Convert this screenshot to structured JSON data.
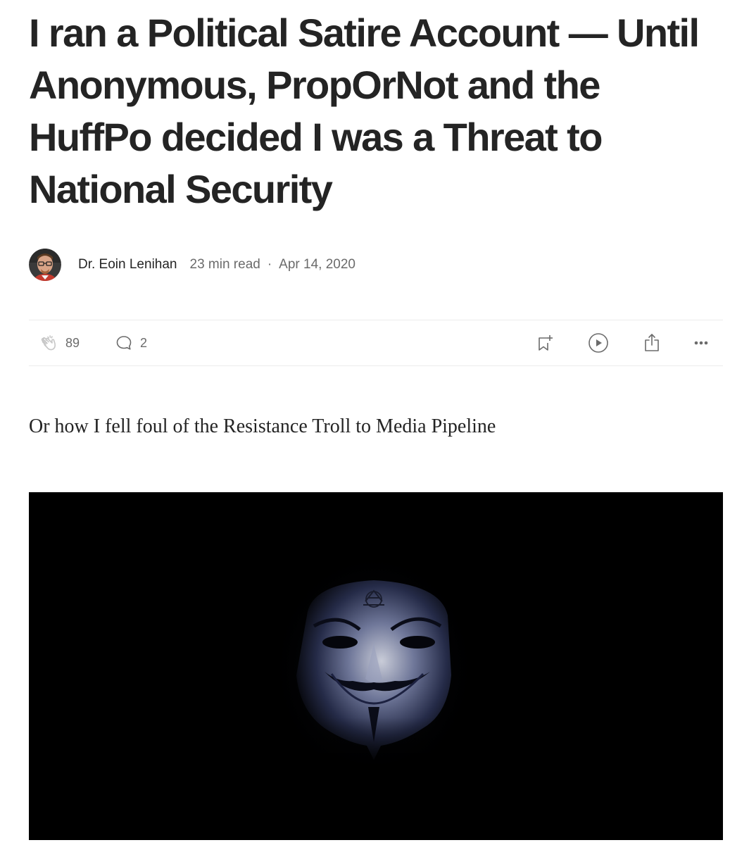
{
  "article": {
    "title": "I ran a Political Satire Account — Until Anonymous, PropOrNot and the HuffPo decided I was a Threat to National Security",
    "subtitle": "Or how I fell foul of the Resistance Troll to Media Pipeline"
  },
  "byline": {
    "author": "Dr. Eoin Lenihan",
    "read_time": "23 min read",
    "separator": "·",
    "date": "Apr 14, 2020"
  },
  "actions": {
    "claps": "89",
    "responses": "2",
    "icons": [
      "clap-icon",
      "comment-icon",
      "bookmark-icon",
      "play-icon",
      "share-icon",
      "more-icon"
    ]
  },
  "colors": {
    "text": "#242424",
    "muted": "#6b6b6b",
    "divider": "#ececec",
    "hero_background": "#000000"
  }
}
